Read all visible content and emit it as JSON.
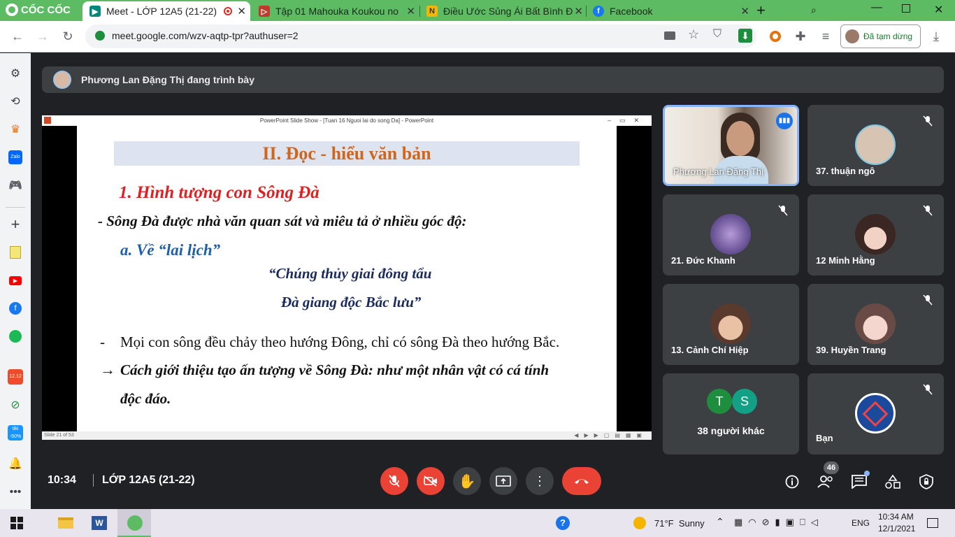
{
  "browser": {
    "brand": "CỐC CỐC",
    "tabs": [
      {
        "title": "Meet - LỚP 12A5 (21-22)",
        "active": true
      },
      {
        "title": "Tập 01 Mahouka Koukou no",
        "active": false
      },
      {
        "title": "Điều Ước Sủng Ái Bất Bình Đ",
        "active": false
      },
      {
        "title": "Facebook",
        "active": false
      }
    ],
    "url": "meet.google.com/wzv-aqtp-tpr?authuser=2",
    "profile_status": "Đã tạm dừng"
  },
  "meet": {
    "presenter_banner": "Phương Lan Đặng Thị đang trình bày",
    "time": "10:34",
    "meeting_name": "LỚP 12A5 (21-22)",
    "participant_count": "46",
    "tiles": [
      {
        "name": "Phương Lan Đặng Thị",
        "kind": "video",
        "speaking": true
      },
      {
        "name": "37. thuận ngô",
        "kind": "avatar",
        "muted": true
      },
      {
        "name": "21. Đức Khanh",
        "kind": "avatar",
        "muted": true
      },
      {
        "name": "12 Minh Hằng",
        "kind": "avatar",
        "muted": true
      },
      {
        "name": "13. Cảnh Chí Hiệp",
        "kind": "avatar",
        "muted": true
      },
      {
        "name": "39. Huyền Trang",
        "kind": "avatar",
        "muted": true
      },
      {
        "name": "38 người khác",
        "kind": "others",
        "initials": [
          "T",
          "S"
        ]
      },
      {
        "name": "Bạn",
        "kind": "avatar",
        "muted": true
      }
    ]
  },
  "slideshow": {
    "window_title": "PowerPoint Slide Show - [Tuan 16 Nguoi lai do song Da] - PowerPoint",
    "status": "Slide 21 of 53",
    "heading": "II. Đọc - hiểu văn bản",
    "line1": "1. Hình tượng con Sông Đà",
    "line2": "- Sông Đà được nhà văn quan sát và miêu tả ở nhiều góc độ:",
    "line3": "a. Về “lai lịch”",
    "quote1": "“Chúng thủy giai đông tẩu",
    "quote2": "Đà giang độc Bắc lưu”",
    "bullet_dash": "-",
    "bullet": "Mọi con sông đều chảy theo hướng Đông, chỉ có sông Đà theo hướng Bắc.",
    "arrow": "→",
    "conclusion1": "Cách giới thiệu tạo ấn tượng về Sông Đà: như một nhân vật  có cá tính",
    "conclusion2": "độc đáo."
  },
  "taskbar": {
    "weather": "71°F  Sunny",
    "lang": "ENG",
    "time": "10:34 AM",
    "date": "12/1/2021"
  },
  "colors": {
    "browser_green": "#5dbb63",
    "meet_bg": "#202124",
    "tile_bg": "#3c4043",
    "end_call_red": "#ea4335",
    "slide_heading": "#d0651c",
    "slide_red": "#e02020",
    "slide_blue": "#1f5fa8",
    "slide_navy": "#1a2a5e"
  }
}
